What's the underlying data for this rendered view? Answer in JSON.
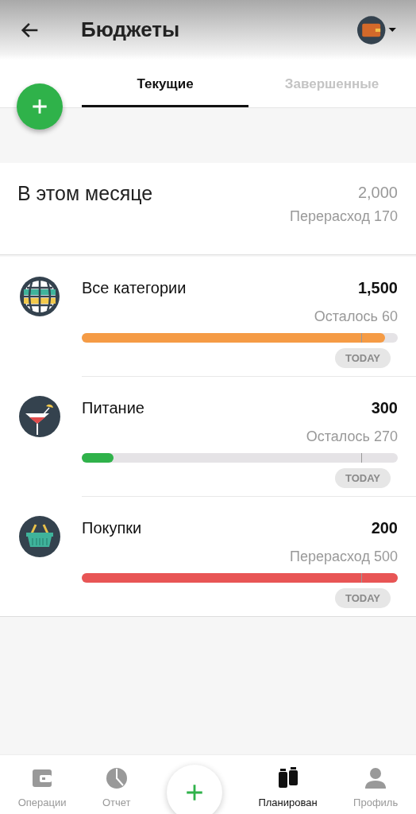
{
  "header": {
    "title": "Бюджеты"
  },
  "tabs": [
    {
      "label": "Текущие",
      "selected": true
    },
    {
      "label": "Завершенные",
      "selected": false
    }
  ],
  "summary": {
    "title": "В этом месяце",
    "amount": "2,000",
    "note": "Перерасход 170"
  },
  "budgets": [
    {
      "name": "Все категории",
      "kind": "globe",
      "amount": "1,500",
      "note": "Осталось 60",
      "level": 0.96,
      "color": "#f59b45",
      "today": "TODAY"
    },
    {
      "name": "Питание",
      "kind": "cocktail",
      "amount": "300",
      "note": "Осталось 270",
      "level": 0.1,
      "color": "#2fb24a",
      "today": "TODAY"
    },
    {
      "name": "Покупки",
      "kind": "basket",
      "amount": "200",
      "note": "Перерасход 500",
      "level": 1,
      "color": "#e85555",
      "today": "TODAY"
    }
  ],
  "nav": [
    {
      "label": "Операции",
      "kind": "wallet",
      "selected": false
    },
    {
      "label": "Отчет",
      "kind": "pie",
      "selected": false
    },
    {
      "label": "Планирован",
      "kind": "jars",
      "selected": true
    },
    {
      "label": "Профиль",
      "kind": "person",
      "selected": false
    }
  ]
}
